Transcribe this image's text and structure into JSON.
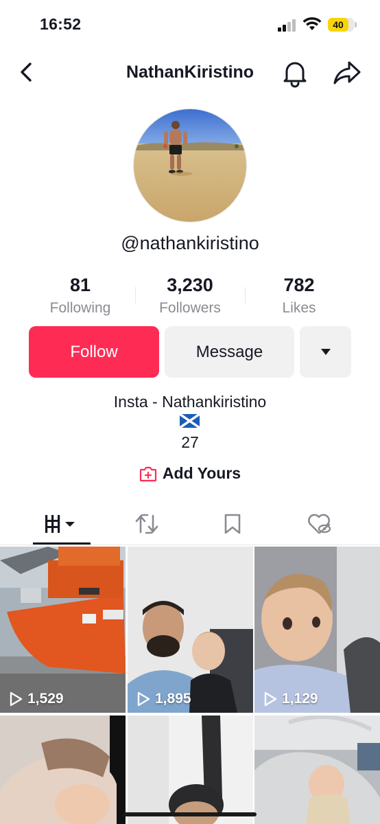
{
  "status_bar": {
    "time": "16:52",
    "battery": "40",
    "battery_level": 0.4
  },
  "header": {
    "title": "NathanKiristino"
  },
  "profile": {
    "username": "@nathankiristino",
    "stats": [
      {
        "value": "81",
        "label": "Following"
      },
      {
        "value": "3,230",
        "label": "Followers"
      },
      {
        "value": "782",
        "label": "Likes"
      }
    ],
    "buttons": {
      "follow": "Follow",
      "message": "Message"
    },
    "bio": {
      "line1": "Insta - Nathankiristino",
      "flag": "scotland-flag-icon",
      "line3": "27"
    },
    "add_yours": "Add Yours"
  },
  "tabs": [
    "videos-tab",
    "reposts-tab",
    "favorites-tab",
    "liked-tab"
  ],
  "videos": [
    {
      "views": "1,529"
    },
    {
      "views": "1,895"
    },
    {
      "views": "1,129"
    },
    {
      "views": ""
    },
    {
      "views": ""
    },
    {
      "views": ""
    }
  ],
  "colors": {
    "accent": "#fe2c55",
    "text": "#161823",
    "muted": "#8a8b91",
    "button_bg": "#f1f1f2"
  }
}
